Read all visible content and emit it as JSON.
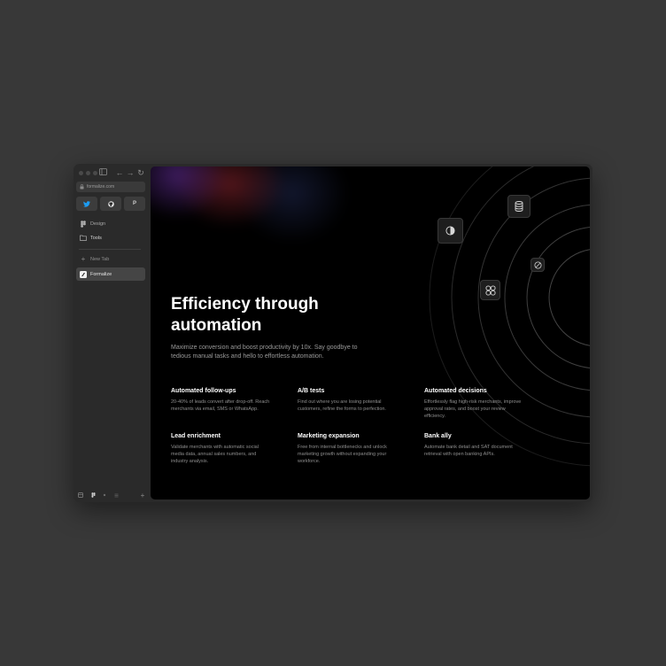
{
  "browser": {
    "url": "formalize.com",
    "favorites": [
      {
        "icon": "twitter-icon",
        "color": "#1d9bf0"
      },
      {
        "icon": "github-icon",
        "color": "#e6e6e6"
      },
      {
        "icon": "p-icon",
        "letter": "P",
        "color": "#cfcfcf"
      }
    ],
    "sidebar_items": [
      {
        "label": "Design",
        "icon": "figma-icon"
      },
      {
        "label": "Tools",
        "icon": "folder-icon"
      }
    ],
    "new_tab_label": "New Tab",
    "active_tab_label": "Formalize"
  },
  "hero": {
    "title_line1": "Efficiency through",
    "title_line2": "automation",
    "subtitle": "Maximize conversion and boost productivity by 10x. Say goodbye to tedious manual tasks and hello to effortless automation."
  },
  "features": [
    {
      "title": "Automated follow-ups",
      "desc": "20-40% of leads convert after drop-off. Reach merchants via email, SMS or WhatsApp."
    },
    {
      "title": "A/B tests",
      "desc": "Find out where you are losing potential customers, refine the forms to perfection."
    },
    {
      "title": "Automated decisions",
      "desc": "Effortlessly flag high-risk merchants, improve approval rates, and boost your review efficiency."
    },
    {
      "title": "Lead enrichment",
      "desc": "Validate merchants with automatic social media data, annual sales numbers, and industry analysis."
    },
    {
      "title": "Marketing expansion",
      "desc": "Free from internal bottlenecks and unlock marketing growth without expanding your workforce."
    },
    {
      "title": "Bank ally",
      "desc": "Automate bank detail and SAT document retrieval with open banking APIs."
    }
  ],
  "colors": {
    "page_bg": "#383838",
    "window_bg": "#2a2a2a",
    "content_bg": "#000000",
    "accent_twitter": "#1d9bf0"
  }
}
